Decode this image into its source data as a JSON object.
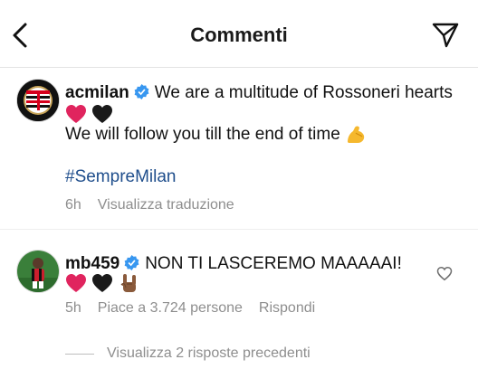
{
  "header": {
    "title": "Commenti"
  },
  "post": {
    "username": "acmilan",
    "text_line1": "We are a multitude of Rossoneri hearts",
    "text_line2": "We will follow you till the end of time",
    "hashtag": "#SempreMilan",
    "time": "6h",
    "translate_label": "Visualizza traduzione"
  },
  "comment": {
    "username": "mb459",
    "text": "NON TI LASCEREMO MAAAAAI!",
    "time": "5h",
    "likes_label": "Piace a 3.724 persone",
    "reply_label": "Rispondi",
    "view_replies_label": "Visualizza 2 risposte precedenti"
  },
  "colors": {
    "verified": "#3897f0",
    "heart_red": "#e0245e",
    "hashtag": "#1f4e8c",
    "muted": "#8e8e8e"
  },
  "icons": [
    "back-arrow-icon",
    "send-icon",
    "verified-icon",
    "red-heart-emoji",
    "black-heart-emoji",
    "flexed-biceps-emoji",
    "rock-on-hand-emoji",
    "heart-outline-icon"
  ]
}
